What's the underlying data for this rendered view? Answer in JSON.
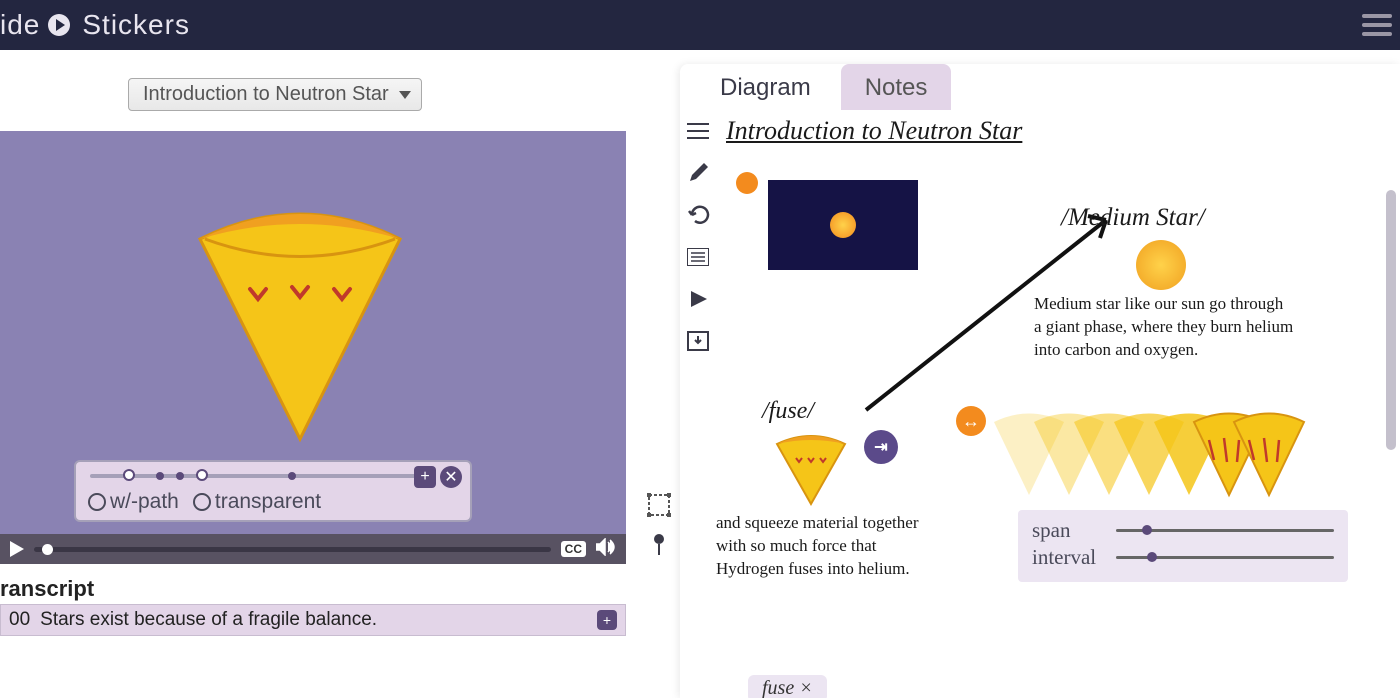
{
  "topbar": {
    "title": "ide",
    "title2": "Stickers"
  },
  "dropdown": {
    "label": "Introduction to Neutron Star"
  },
  "overlay": {
    "opt1": "w/-path",
    "opt2": "transparent",
    "plus": "+",
    "close": "✕"
  },
  "playbar": {
    "cc": "CC"
  },
  "transcript": {
    "title": "ranscript",
    "line_time": "00",
    "line_text": "Stars exist because of a fragile balance."
  },
  "tabs": {
    "diagram": "Diagram",
    "notes": "Notes"
  },
  "canvas": {
    "title": "Introduction to Neutron Star",
    "medium_label": "/Medium Star/",
    "medium_text": "Medium star like our sun go through a giant phase, where they burn helium into carbon and oxygen.",
    "fuse_label": "/fuse/",
    "fuse_text": "and squeeze material together with so much force that Hydrogen fuses into helium.",
    "span_label": "span",
    "interval_label": "interval",
    "bottom_chip": "fuse ×"
  },
  "icons": {
    "purp": "⇥",
    "orange": "↔"
  }
}
